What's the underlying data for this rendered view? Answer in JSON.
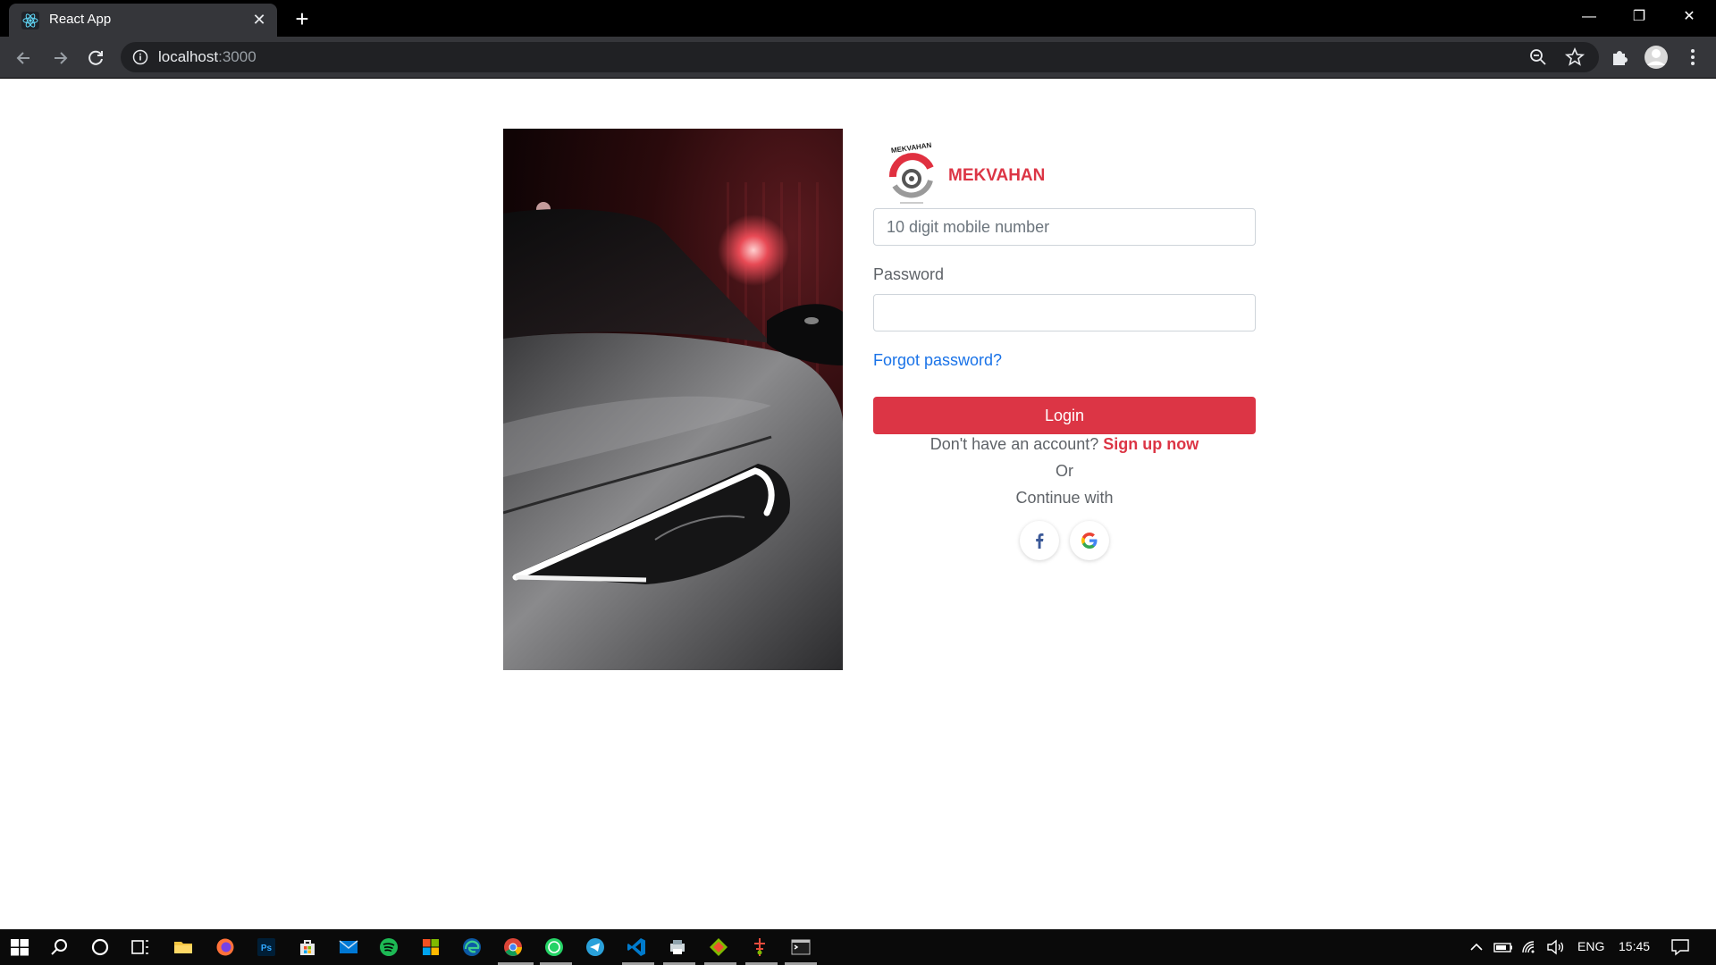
{
  "browser": {
    "tab_title": "React App",
    "url_host": "localhost",
    "url_port": ":3000",
    "tab_close_icon": "close-icon",
    "new_tab_icon": "plus-icon"
  },
  "window_controls": {
    "minimize": "—",
    "restore": "❐",
    "close": "✕"
  },
  "login": {
    "brand_name": "MEKVAHAN",
    "logo_text": "MEKVAHAN",
    "mobile_placeholder": "10 digit mobile number",
    "mobile_value": "",
    "password_label": "Password",
    "password_value": "",
    "forgot_password": "Forgot password?",
    "login_button": "Login",
    "no_account_text": "Don't have an account?",
    "signup_link": "Sign up now",
    "or_text": "Or",
    "continue_with": "Continue with",
    "social": [
      "facebook-icon",
      "google-icon"
    ]
  },
  "colors": {
    "brand_red": "#dc3545",
    "link_blue": "#1a73e8"
  },
  "taskbar": {
    "language": "ENG",
    "time": "15:45"
  }
}
